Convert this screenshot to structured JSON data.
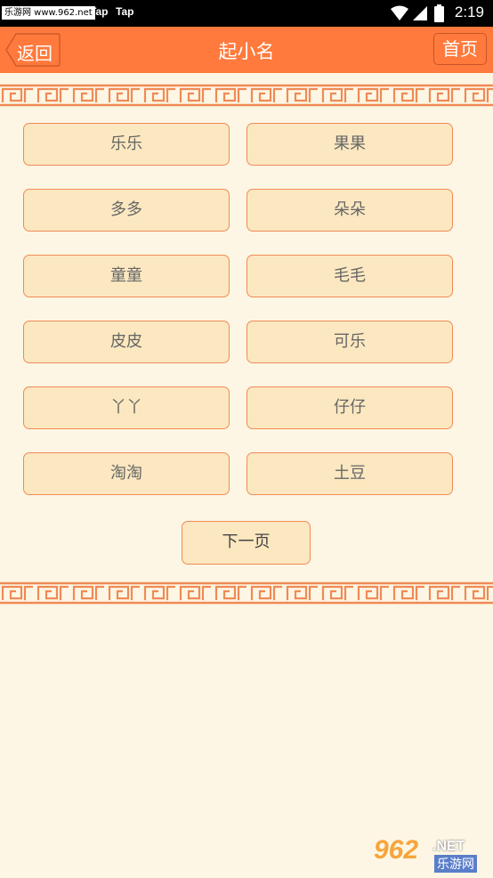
{
  "status_bar": {
    "watermark": "乐游网 www.962.net",
    "app1": "Tap",
    "app2": "Tap",
    "time": "2:19"
  },
  "header": {
    "back_label": "返回",
    "title": "起小名",
    "home_label": "首页"
  },
  "names": [
    "乐乐",
    "果果",
    "多多",
    "朵朵",
    "童童",
    "毛毛",
    "皮皮",
    "可乐",
    "丫丫",
    "仔仔",
    "淘淘",
    "土豆"
  ],
  "next_label": "下一页",
  "footer_watermark": {
    "number": "962",
    "suffix": ".NET",
    "site": "乐游网"
  },
  "colors": {
    "accent": "#ff7a3c",
    "background": "#fdf6e4",
    "button_fill": "#fbe8c0",
    "button_border": "#f08a56"
  }
}
